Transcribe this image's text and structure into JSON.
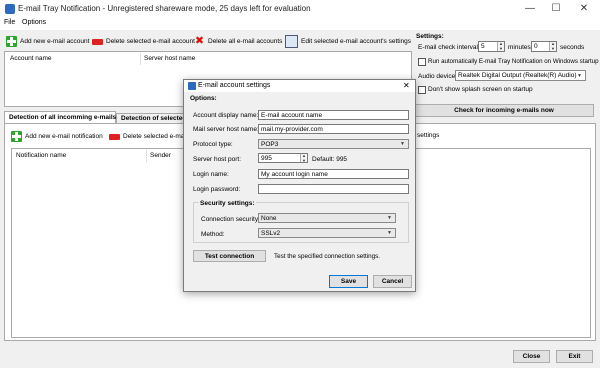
{
  "window": {
    "title": "E-mail Tray Notification - Unregistered shareware mode, 25 days left for evaluation",
    "minimize": "—",
    "maximize": "☐",
    "close": "✕"
  },
  "menu": {
    "items": [
      "File",
      "Options"
    ]
  },
  "accounts_toolbar": {
    "add": "Add new e-mail account",
    "delete_selected": "Delete selected e-mail account",
    "delete_all": "Delete all e-mail accounts",
    "edit": "Edit selected e-mail account's settings"
  },
  "accounts_table": {
    "columns": [
      "Account name",
      "Server host name"
    ]
  },
  "settings": {
    "heading": "Settings:",
    "interval_label": "E-mail check interval:",
    "interval_minutes": "5",
    "minutes_label": "minutes",
    "interval_seconds": "0",
    "seconds_label": "seconds",
    "autostart_label": "Run automatically E-mail Tray Notification on Windows startup",
    "audio_label": "Audio device:",
    "audio_value": "Realtek Digital Output (Realtek(R) Audio)",
    "splash_label": "Don't show splash screen on startup",
    "check_button": "Check for incoming e-mails now"
  },
  "tabs": [
    "Detection of all incomming e-mails",
    "Detection of selected"
  ],
  "detection_toolbar": {
    "add": "Add new e-mail notification",
    "delete_selected": "Delete selected e-mail n",
    "settings_suffix": "settings"
  },
  "notifications_table": {
    "columns": [
      "Notification name",
      "Sender"
    ]
  },
  "bottom": {
    "close": "Close",
    "exit": "Exit"
  },
  "dialog": {
    "title": "E-mail account settings",
    "close": "✕",
    "options_heading": "Options:",
    "display_name_label": "Account display name:",
    "display_name_value": "E-mail account name",
    "host_label": "Mail server host name:",
    "host_value": "mail.my-provider.com",
    "protocol_label": "Protocol type:",
    "protocol_value": "POP3",
    "port_label": "Server host port:",
    "port_value": "995",
    "port_default": "Default: 995",
    "login_label": "Login name:",
    "login_value": "My account login name",
    "password_label": "Login password:",
    "password_value": "",
    "security_heading": "Security settings:",
    "connection_label": "Connection security:",
    "connection_value": "None",
    "method_label": "Method:",
    "method_value": "SSLv2",
    "test_button": "Test connection",
    "test_hint": "Test the specified connection settings.",
    "save_button": "Save",
    "cancel_button": "Cancel"
  }
}
